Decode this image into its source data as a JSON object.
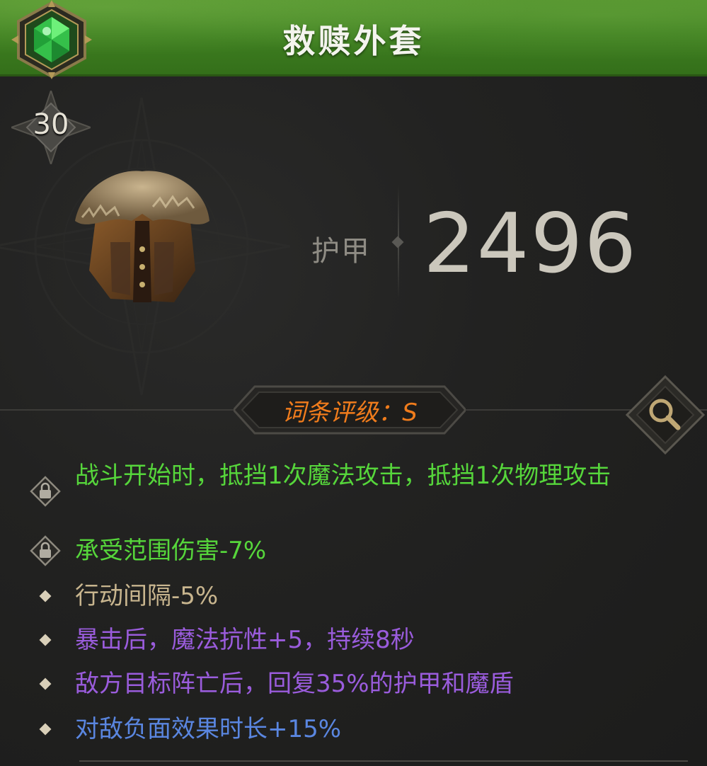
{
  "header": {
    "title": "救赎外套",
    "colors": {
      "header_green": "#3e7f20",
      "gem_green": "#3cd24a"
    }
  },
  "level": "30",
  "armor": {
    "label": "护甲",
    "value": "2496"
  },
  "rating": {
    "text": "词条评级：S",
    "color": "#f07c1c"
  },
  "affixes": [
    {
      "text": "战斗开始时，抵挡1次魔法攻击，抵挡1次物理攻击",
      "color": "#56d63b",
      "icon": "lock-icon"
    },
    {
      "text": "承受范围伤害-7%",
      "color": "#56d63b",
      "icon": "lock-icon"
    },
    {
      "text": "行动间隔-5%",
      "color": "#c8b58e",
      "icon": "diamond-bullet-icon"
    },
    {
      "text": "暴击后，魔法抗性+5，持续8秒",
      "color": "#9a5cdc",
      "icon": "diamond-bullet-icon"
    },
    {
      "text": "敌方目标阵亡后，回复35%的护甲和魔盾",
      "color": "#9a5cdc",
      "icon": "diamond-bullet-icon"
    },
    {
      "text": "对敌负面效果时长+15%",
      "color": "#5a86e0",
      "icon": "diamond-bullet-icon"
    }
  ]
}
